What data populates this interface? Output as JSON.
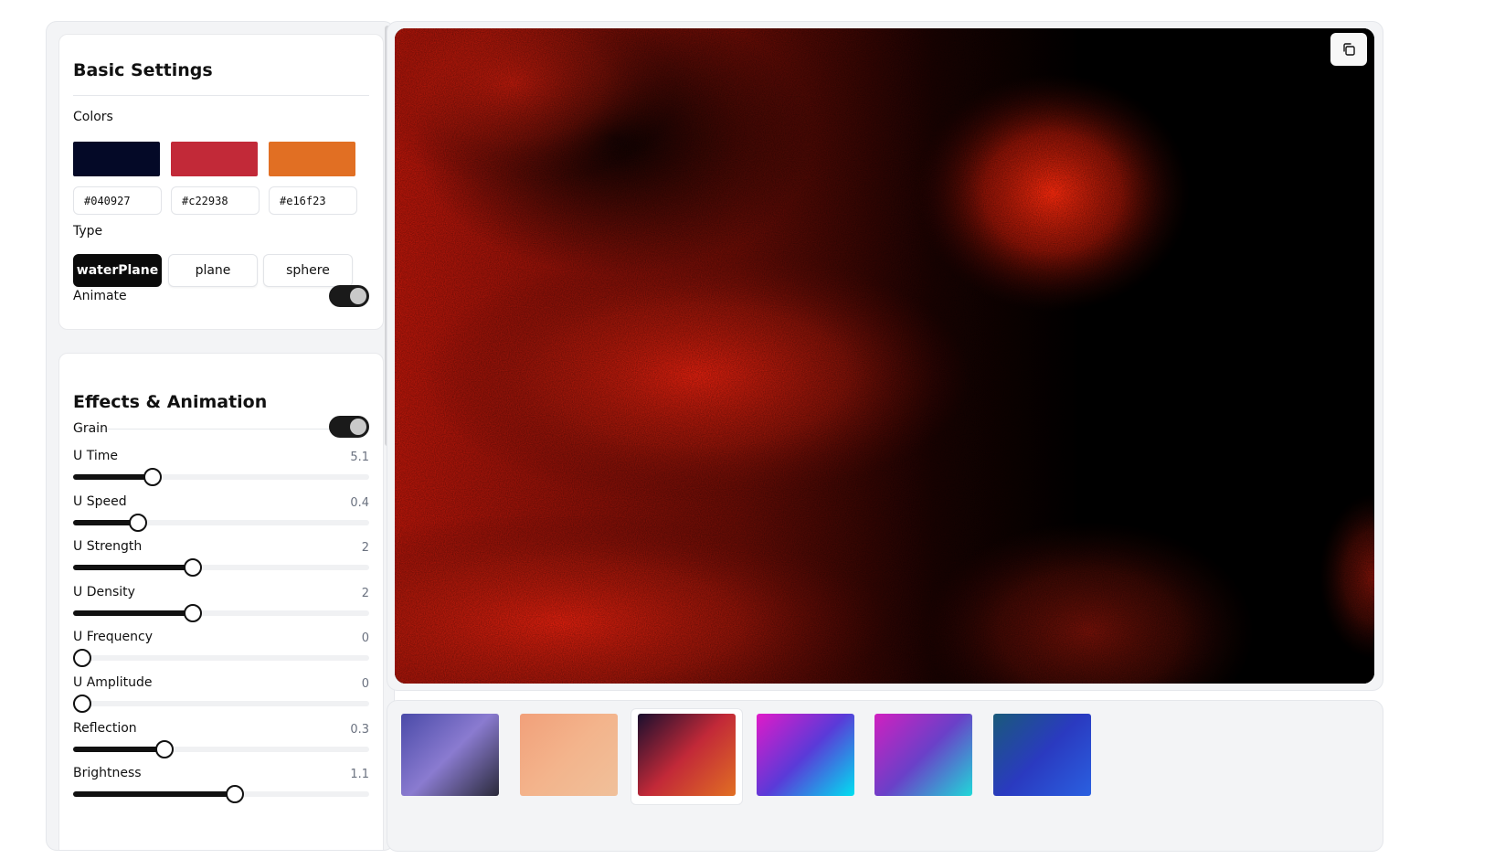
{
  "basic": {
    "title": "Basic Settings",
    "colors_label": "Colors",
    "colors": [
      {
        "hex": "#040927"
      },
      {
        "hex": "#c22938"
      },
      {
        "hex": "#e16f23"
      }
    ],
    "type_label": "Type",
    "types": [
      "waterPlane",
      "plane",
      "sphere"
    ],
    "active_type": "waterPlane",
    "animate_label": "Animate",
    "animate_on": true
  },
  "effects": {
    "title": "Effects & Animation",
    "grain_label": "Grain",
    "grain_on": true,
    "sliders": [
      {
        "label": "U Time",
        "value": "5.1",
        "fraction": 0.27
      },
      {
        "label": "U Speed",
        "value": "0.4",
        "fraction": 0.22
      },
      {
        "label": "U Strength",
        "value": "2",
        "fraction": 0.405
      },
      {
        "label": "U Density",
        "value": "2",
        "fraction": 0.405
      },
      {
        "label": "U Frequency",
        "value": "0",
        "fraction": 0.03
      },
      {
        "label": "U Amplitude",
        "value": "0",
        "fraction": 0.03
      },
      {
        "label": "Reflection",
        "value": "0.3",
        "fraction": 0.31
      },
      {
        "label": "Brightness",
        "value": "1.1",
        "fraction": 0.545
      }
    ]
  },
  "preview": {
    "copy_icon": "copy-icon"
  },
  "presets": [
    {
      "name": "preset-violet-gray",
      "from": "#4a4aa8",
      "mid": "#8a7bd0",
      "to": "#2a2a3a"
    },
    {
      "name": "preset-peach",
      "from": "#f2a07a",
      "mid": "#f3b48c",
      "to": "#f0c09a"
    },
    {
      "name": "preset-crimson-orange",
      "from": "#1a0f2e",
      "mid": "#c22938",
      "to": "#e16f23"
    },
    {
      "name": "preset-magenta-cyan",
      "from": "#e01ac8",
      "mid": "#5a3ad8",
      "to": "#00e0f0"
    },
    {
      "name": "preset-pink-teal",
      "from": "#d020c0",
      "mid": "#6a40c8",
      "to": "#20d8d8"
    },
    {
      "name": "preset-teal-blue",
      "from": "#1a5a7a",
      "mid": "#2a3ac0",
      "to": "#2a60e0"
    }
  ],
  "active_preset": 2
}
